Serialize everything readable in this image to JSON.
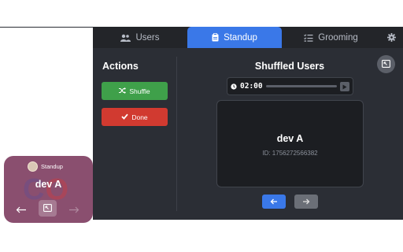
{
  "tabs": [
    {
      "label": "Users",
      "icon": "users-icon"
    },
    {
      "label": "Standup",
      "icon": "clipboard-icon",
      "active": true
    },
    {
      "label": "Grooming",
      "icon": "list-check-icon"
    },
    {
      "label": "",
      "icon": "gear-icon"
    }
  ],
  "actions": {
    "title": "Actions",
    "shuffle_label": "Shuffle",
    "done_label": "Done"
  },
  "main": {
    "title": "Shuffled Users",
    "timer": "02:00",
    "current_user": {
      "name": "dev A",
      "id_text": "ID: 1756272566382"
    }
  },
  "overlay": {
    "header": "Standup",
    "name": "dev A"
  },
  "colors": {
    "accent": "#3a78e8",
    "shuffle": "#3fa04a",
    "done": "#d13a30",
    "panel_bg": "#2b2e35",
    "overlay_bg": "#8a4f6f"
  }
}
